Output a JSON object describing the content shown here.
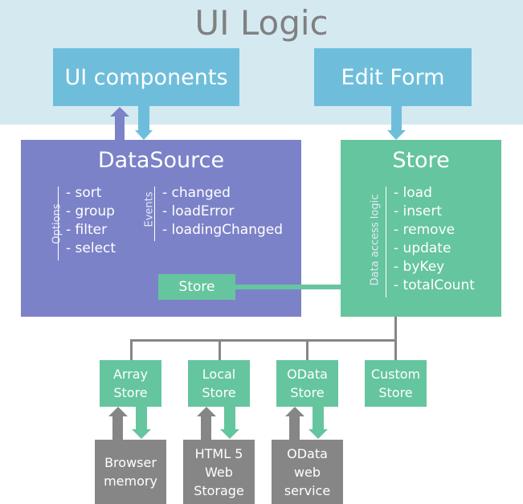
{
  "title": "UI Logic",
  "ui_components": {
    "label": "UI components"
  },
  "edit_form": {
    "label": "Edit Form"
  },
  "datasource": {
    "title": "DataSource",
    "options_label": "Options",
    "options": [
      "- sort",
      "- group",
      "- filter",
      "- select"
    ],
    "events_label": "Events",
    "events": [
      "- changed",
      "- loadError",
      "- loadingChanged"
    ],
    "store_label": "Store"
  },
  "store": {
    "title": "Store",
    "logic_label": "Data access logic",
    "methods": [
      "- load",
      "- insert",
      "- remove",
      "- update",
      "- byKey",
      "- totalCount"
    ]
  },
  "store_types": [
    {
      "line1": "Array",
      "line2": "Store"
    },
    {
      "line1": "Local",
      "line2": "Store"
    },
    {
      "line1": "OData",
      "line2": "Store"
    },
    {
      "line1": "Custom",
      "line2": "Store"
    }
  ],
  "backends": [
    {
      "lines": [
        "Browser",
        "memory"
      ]
    },
    {
      "lines": [
        "HTML 5",
        "Web",
        "Storage"
      ]
    },
    {
      "lines": [
        "OData",
        "web",
        "service"
      ]
    }
  ],
  "colors": {
    "ui_band": "#d5e9f1",
    "ui_box": "#6ebedb",
    "datasource": "#7c82c8",
    "store": "#65c59e",
    "backend": "#868686",
    "title_text": "#808080"
  }
}
